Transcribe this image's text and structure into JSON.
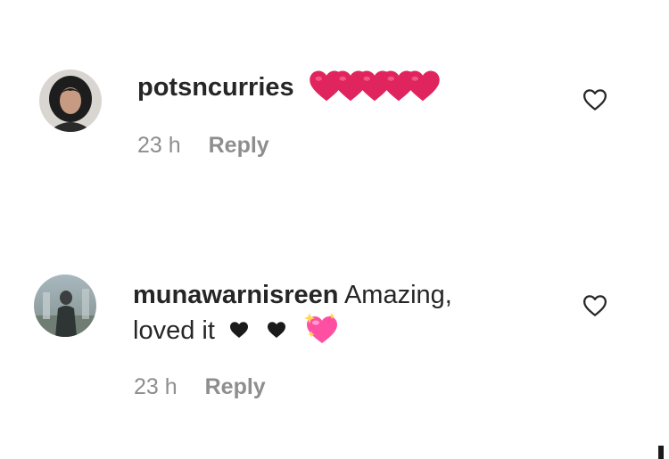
{
  "comments": [
    {
      "username": "potsncurries",
      "text": "",
      "emojis": [
        "heart-emoji-red",
        "heart-emoji-red",
        "heart-emoji-red",
        "heart-emoji-red",
        "heart-emoji-red"
      ],
      "time": "23 h",
      "reply_label": "Reply"
    },
    {
      "username": "munawarnisreen",
      "text_line1": "Amazing,",
      "text_line2": "loved it",
      "emojis": [
        "black-heart-icon",
        "black-heart-icon",
        "sparkling-heart-emoji"
      ],
      "time": "23 h",
      "reply_label": "Reply"
    }
  ],
  "colors": {
    "text": "#262626",
    "meta": "#8e8e8e",
    "heart_red": "#e0245e",
    "sparkle_pink": "#ff4fa3"
  },
  "icons": {
    "like": "heart-outline-icon"
  }
}
